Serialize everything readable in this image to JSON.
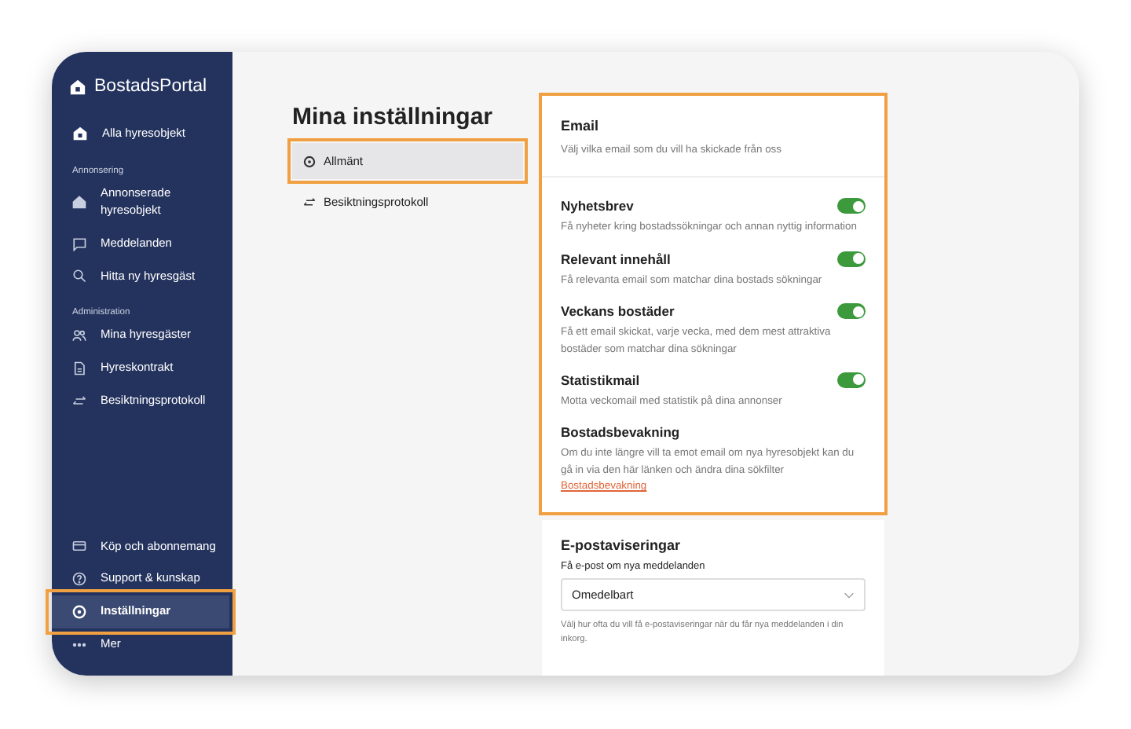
{
  "sidebar": {
    "logo": "BostadsPortal",
    "top_item": {
      "label": "Alla hyresobjekt",
      "selected": false
    },
    "sections": [
      {
        "heading": "Annonsering",
        "items": [
          {
            "label": "Annonserade hyresobjekt",
            "selected": false,
            "highlighted": false
          },
          {
            "label": "Meddelanden",
            "selected": false,
            "highlighted": false
          },
          {
            "label": "Hitta ny hyresgäst",
            "selected": false,
            "highlighted": false
          }
        ]
      },
      {
        "heading": "Administration",
        "items": [
          {
            "label": "Mina hyresgäster",
            "selected": false,
            "highlighted": false
          },
          {
            "label": "Hyreskontrakt",
            "selected": false,
            "highlighted": false
          },
          {
            "label": "Besiktningsprotokoll",
            "selected": false,
            "highlighted": false
          }
        ]
      }
    ],
    "bottom_items": [
      {
        "label": "Köp och abonnemang",
        "selected": false,
        "highlighted": false
      },
      {
        "label": "Support & kunskap",
        "selected": false,
        "highlighted": false
      },
      {
        "label": "Inställningar",
        "selected": true,
        "highlighted": true
      },
      {
        "label": "Mer",
        "selected": false,
        "highlighted": false
      }
    ]
  },
  "page": {
    "title": "Mina inställningar",
    "subnav": [
      {
        "label": "Allmänt",
        "selected": true,
        "highlighted": true
      },
      {
        "label": "Besiktningsprotokoll",
        "selected": false,
        "highlighted": false
      }
    ]
  },
  "email_card": {
    "highlighted": true,
    "title": "Email",
    "description": "Välj vilka email som du vill ha skickade från oss",
    "settings": [
      {
        "kind": "toggle",
        "title": "Nyhetsbrev",
        "on": true,
        "description": "Få nyheter kring bostadssökningar och annan nyttig information"
      },
      {
        "kind": "toggle",
        "title": "Relevant innehåll",
        "on": true,
        "description": "Få relevanta email som matchar dina bostads sökningar"
      },
      {
        "kind": "toggle",
        "title": "Veckans bostäder",
        "on": true,
        "description": "Få ett email skickat, varje vecka, med dem mest attraktiva bostäder som matchar dina sökningar"
      },
      {
        "kind": "toggle",
        "title": "Statistikmail",
        "on": true,
        "description": "Motta veckomail med statistik på dina annonser"
      },
      {
        "kind": "link",
        "title": "Bostadsbevakning",
        "description": "Om du inte längre vill ta emot email om nya hyresobjekt kan du gå in via den här länken och ändra dina sökfilter",
        "link": "Bostadsbevakning"
      }
    ]
  },
  "notifications_card": {
    "title": "E-postaviseringar",
    "label": "Få e-post om nya meddelanden",
    "value": "Omedelbart",
    "help": "Välj hur ofta du vill få e-postaviseringar när du får nya meddelanden i din inkorg."
  }
}
